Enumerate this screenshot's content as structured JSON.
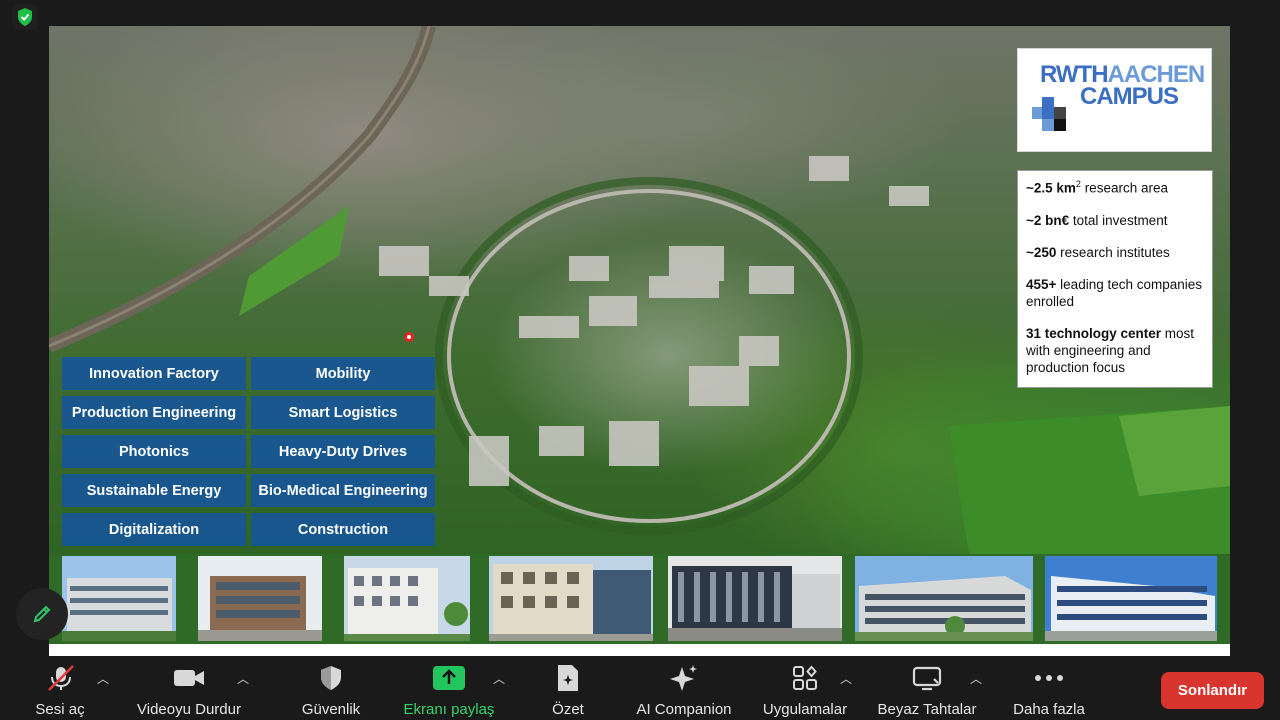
{
  "slide": {
    "logo": {
      "line1_dark": "RWTH",
      "line1_light": "AACHEN",
      "line2": "CAMPUS"
    },
    "stats": [
      {
        "bold": "~2.5 km",
        "sup": "2",
        "rest": " research area"
      },
      {
        "bold": "~2 bn€",
        "rest": " total investment"
      },
      {
        "bold": "~250",
        "rest": " research institutes"
      },
      {
        "bold": "455+",
        "rest": " leading tech companies enrolled"
      },
      {
        "bold": "31 technology center",
        "rest": " most with engineering and production focus"
      }
    ],
    "categories": [
      "Innovation Factory",
      "Mobility",
      "Production Engineering",
      "Smart Logistics",
      "Photonics",
      "Heavy-Duty Drives",
      "Sustainable Energy",
      "Bio-Medical Engineering",
      "Digitalization",
      "Construction"
    ]
  },
  "toolbar": {
    "mute_label": "Sesi aç",
    "video_label": "Videoyu Durdur",
    "security_label": "Güvenlik",
    "share_label": "Ekranı paylaş",
    "summary_label": "Özet",
    "ai_label": "AI Companion",
    "apps_label": "Uygulamalar",
    "whiteboard_label": "Beyaz Tahtalar",
    "more_label": "Daha fazla",
    "end_label": "Sonlandır"
  },
  "colors": {
    "accent_green": "#22c55e",
    "end_red": "#d9352f",
    "category_blue": "#1554a0"
  }
}
